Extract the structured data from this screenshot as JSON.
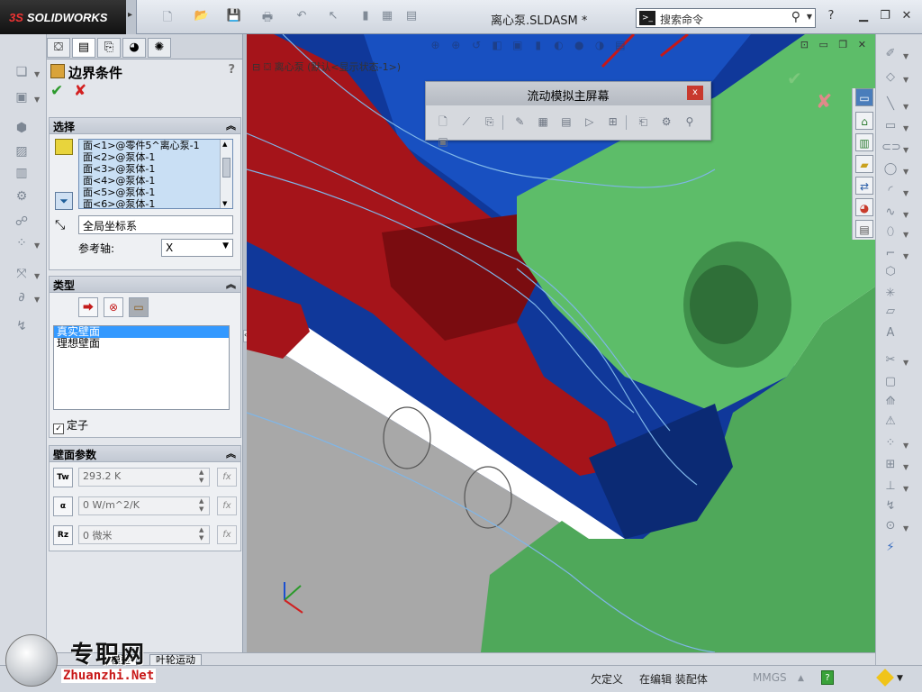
{
  "app": {
    "logo_text": "SOLIDWORKS",
    "logo_prefix": "3S",
    "document_title": "离心泵.SLDASM *"
  },
  "search": {
    "placeholder": "搜索命令",
    "cmd_glyph": ">_"
  },
  "property_manager": {
    "title": "边界条件",
    "help": "?",
    "ok_glyph": "✔",
    "cancel_glyph": "✘",
    "selection": {
      "title": "选择",
      "faces": [
        "面<1>@零件5^离心泵-1",
        "面<2>@泵体-1",
        "面<3>@泵体-1",
        "面<4>@泵体-1",
        "面<5>@泵体-1",
        "面<6>@泵体-1"
      ],
      "coordinate_system": "全局坐标系",
      "reference_axis_label": "参考轴:",
      "reference_axis_value": "X"
    },
    "type": {
      "title": "类型",
      "options": [
        "真实壁面",
        "理想壁面"
      ],
      "selected_index": 0,
      "stator_label": "定子",
      "stator_checked": true
    },
    "wall_parameters": {
      "title": "壁面参数",
      "rows": [
        {
          "icon": "Tw",
          "value": "293.2 K"
        },
        {
          "icon": "α",
          "value": "0 W/m^2/K"
        },
        {
          "icon": "Rz",
          "value": "0 微米"
        }
      ],
      "fx_label": "fx"
    }
  },
  "viewport": {
    "tree_label": "离心泵 (默认<显示状态-1>)",
    "flow_panel": {
      "title": "流动模拟主屏幕",
      "close": "x"
    },
    "colors": {
      "red_part": "#a5141a",
      "green_part": "#4fa85a",
      "blue_housing": "#10389a",
      "gray_part": "#a8a8a8",
      "streamline": "#7fb6e8"
    }
  },
  "bottom_tabs": [
    "模型",
    "叶轮运动"
  ],
  "status_bar": {
    "underdefined": "欠定义",
    "editing": "在编辑 装配体",
    "units": "MMGS",
    "help": "?"
  },
  "watermark": {
    "cn": "专职网",
    "en": "Zhuanzhi.Net"
  }
}
